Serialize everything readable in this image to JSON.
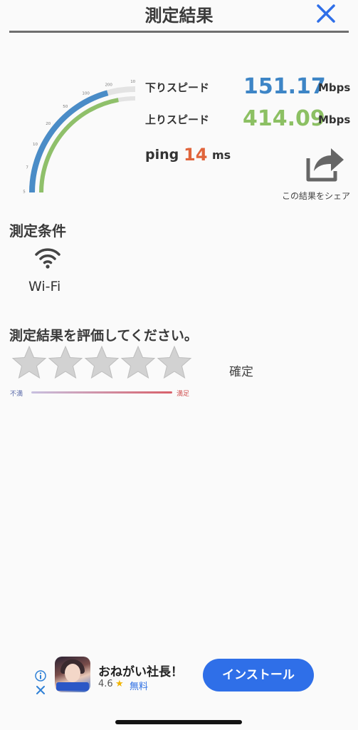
{
  "header": {
    "title": "測定結果",
    "close_icon": "close-icon"
  },
  "gauge": {
    "ticks": [
      "5",
      "7",
      "10",
      "20",
      "50",
      "100",
      "200",
      "10"
    ],
    "download_color": "#4a8cc7",
    "upload_color": "#8fc06a",
    "track_color": "#e3e3e3"
  },
  "results": {
    "download": {
      "label": "下りスピード",
      "value": "151.17",
      "unit": "Mbps",
      "color": "#3d85c6"
    },
    "upload": {
      "label": "上りスピード",
      "value": "414.09",
      "unit": "Mbps",
      "color": "#8cc063"
    },
    "ping": {
      "label": "ping",
      "value": "14",
      "unit": "ms",
      "color": "#e0643b"
    }
  },
  "share": {
    "label": "この結果をシェア",
    "icon": "share-icon"
  },
  "conditions": {
    "title": "測定条件",
    "network": "Wi-Fi",
    "icon": "wifi-icon"
  },
  "rating": {
    "title": "測定結果を評価してください。",
    "stars": 5,
    "selected": 0,
    "confirm": "確定",
    "min_label": "不満",
    "max_label": "満足"
  },
  "ad": {
    "title": "おねがい社長！",
    "rating": "4.6",
    "price": "無料",
    "install": "インストール",
    "info_icon": "info-icon",
    "close_icon": "close-icon"
  }
}
